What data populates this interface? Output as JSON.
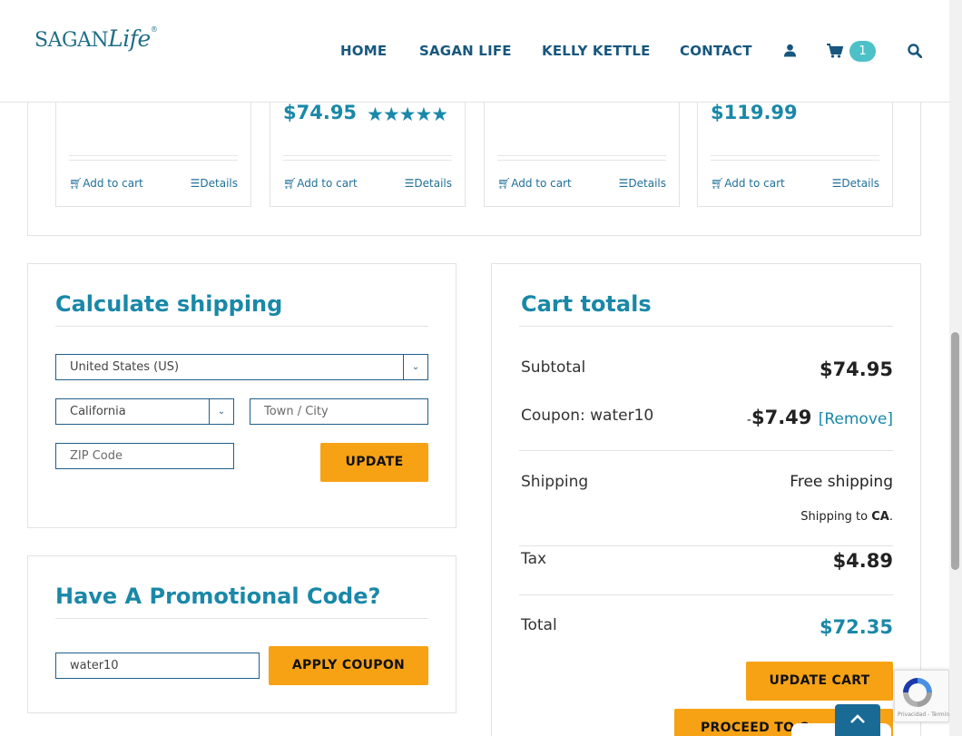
{
  "header": {
    "logo_main": "SAGAN",
    "logo_life": "Life",
    "nav": [
      "HOME",
      "SAGAN LIFE",
      "KELLY KETTLE",
      "CONTACT"
    ],
    "cart_count": "1"
  },
  "products": [
    {
      "price": "",
      "rating_stars": 0,
      "add": "Add to cart",
      "details": "Details"
    },
    {
      "price": "$74.95",
      "rating_stars": 5,
      "stars": "★★★★★",
      "add": "Add to cart",
      "details": "Details"
    },
    {
      "price": "",
      "rating_stars": 0,
      "add": "Add to cart",
      "details": "Details"
    },
    {
      "price": "$119.99",
      "rating_stars": 0,
      "add": "Add to cart",
      "details": "Details"
    }
  ],
  "shipping": {
    "title": "Calculate shipping",
    "country": "United States (US)",
    "state": "California",
    "city_placeholder": "Town / City",
    "zip_placeholder": "ZIP Code",
    "update_label": "UPDATE"
  },
  "promo": {
    "title": "Have A Promotional Code?",
    "code": "water10",
    "apply_label": "APPLY COUPON"
  },
  "totals": {
    "title": "Cart totals",
    "subtotal_label": "Subtotal",
    "subtotal_value": "$74.95",
    "coupon_label": "Coupon: water10",
    "coupon_minus": "-",
    "coupon_value": "$7.49",
    "coupon_remove": "[Remove]",
    "shipping_label": "Shipping",
    "shipping_value": "Free shipping",
    "shipping_to_prefix": "Shipping to ",
    "shipping_to_region": "CA",
    "shipping_to_suffix": ".",
    "tax_label": "Tax",
    "tax_value": "$4.89",
    "total_label": "Total",
    "total_value": "$72.35",
    "update_cart_label": "UPDATE CART",
    "checkout_label": "PROCEED TO C"
  },
  "recaptcha": {
    "text": "Privacidad - Términos"
  },
  "colors": {
    "accent": "#1a88a8",
    "button": "#f7a214",
    "nav": "#17577f",
    "badge": "#4cc1c7"
  }
}
